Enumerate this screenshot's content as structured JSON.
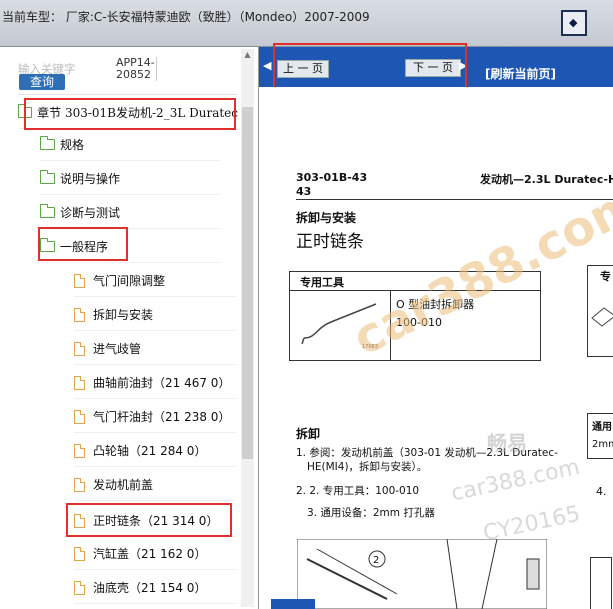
{
  "header": {
    "title": "当前车型：  厂家:C-长安福特蒙迪欧（致胜）（Mondeo）2007-2009",
    "tool_button_glyph": "◆"
  },
  "search": {
    "placeholder": "输入关键字",
    "value_line1": "APP14-",
    "value_line2": "20852",
    "query_label": "查询"
  },
  "tree": {
    "chapter": "章节 303-01B发动机-2_3L Duratec",
    "folders": [
      "规格",
      "说明与操作",
      "诊断与测试",
      "一般程序"
    ],
    "docs": [
      "气门间隙调整",
      "拆卸与安装",
      "进气歧管",
      "曲轴前油封（21 467 0）",
      "气门杆油封（21 238 0）",
      "凸轮轴（21 284 0）",
      "发动机前盖",
      "正时链条（21 314 0）",
      "汽缸盖（21 162 0）",
      "油底壳（21 154 0）"
    ]
  },
  "nav": {
    "prev": "上 一 页",
    "next": "下 一 页",
    "refresh": "[刷新当前页]"
  },
  "doc": {
    "code_line1": "303-01B-43",
    "code_line2": "43",
    "header_right": "发动机—2.3L Duratec-H",
    "section": "拆卸与安装",
    "title": "正时链条",
    "tools_header": "专用工具",
    "tools_header2": "专",
    "tool_name": "O 型油封拆卸器",
    "tool_number": "100-010",
    "tool_img_code": "17063",
    "removal_title": "拆卸",
    "step1": "1. 参阅：发动机前盖（303-01 发动机—2.3L Duratec-",
    "step1b": "HE(MI4)，拆卸与安装）。",
    "step2": "2. 2. 专用工具：100-010",
    "step3": "3. 通用设备：2mm 打孔器",
    "right_col1": "通用",
    "right_col2": "2mm",
    "right_col3": "4.",
    "fig_label": "2",
    "watermark_main": "car388.com",
    "watermark_cn": "畅易",
    "watermark_url": "car388.com",
    "watermark_id": "CY20165"
  }
}
